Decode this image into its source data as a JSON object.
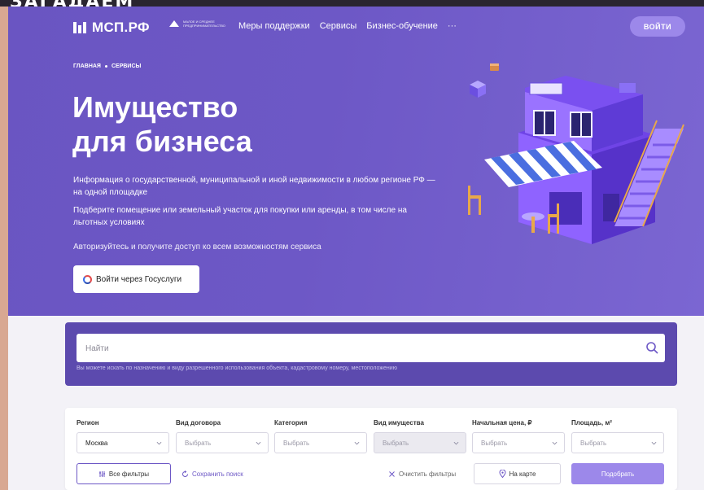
{
  "top_strip_text": "ЗАГАДАЕМ",
  "header": {
    "logo_text": "МСП.РФ",
    "partner_text": "МАЛОЕ И СРЕДНЕЕ ПРЕДПРИНИМАТЕЛЬСТВО",
    "nav": [
      "Меры поддержки",
      "Сервисы",
      "Бизнес-обучение",
      "···"
    ],
    "login_label": "ВОЙТИ"
  },
  "breadcrumb": [
    "ГЛАВНАЯ",
    "СЕРВИСЫ"
  ],
  "hero": {
    "title_line1": "Имущество",
    "title_line2": "для бизнеса",
    "desc1": "Информация о государственной, муниципальной и иной недвижимости в любом регионе РФ — на одной площадке",
    "desc2": "Подберите помещение или земельный участок для покупки или аренды, в том числе на льготных условиях",
    "desc3": "Авторизуйтесь и получите доступ ко всем возможностям сервиса",
    "gosuslugi_label": "Войти через Госуслуги"
  },
  "search": {
    "placeholder": "Найти",
    "hint": "Вы можете искать по назначению и виду разрешенного использования объекта, кадастровому номеру, местоположению"
  },
  "filters": {
    "fields": [
      {
        "label": "Регион",
        "value": "Москва"
      },
      {
        "label": "Вид договора",
        "value": "Выбрать"
      },
      {
        "label": "Категория",
        "value": "Выбрать"
      },
      {
        "label": "Вид имущества",
        "value": "Выбрать"
      },
      {
        "label": "Начальная цена, ₽",
        "value": "Выбрать"
      },
      {
        "label": "Площадь, м²",
        "value": "Выбрать"
      }
    ],
    "all_filters_label": "Все фильтры",
    "save_search_label": "Сохранить поиск",
    "clear_label": "Очистить фильтры",
    "map_label": "На карте",
    "submit_label": "Подобрать"
  },
  "colors": {
    "hero_bg": "#6d58c6",
    "accent": "#9c88ea",
    "search_panel": "#5c4aae"
  }
}
